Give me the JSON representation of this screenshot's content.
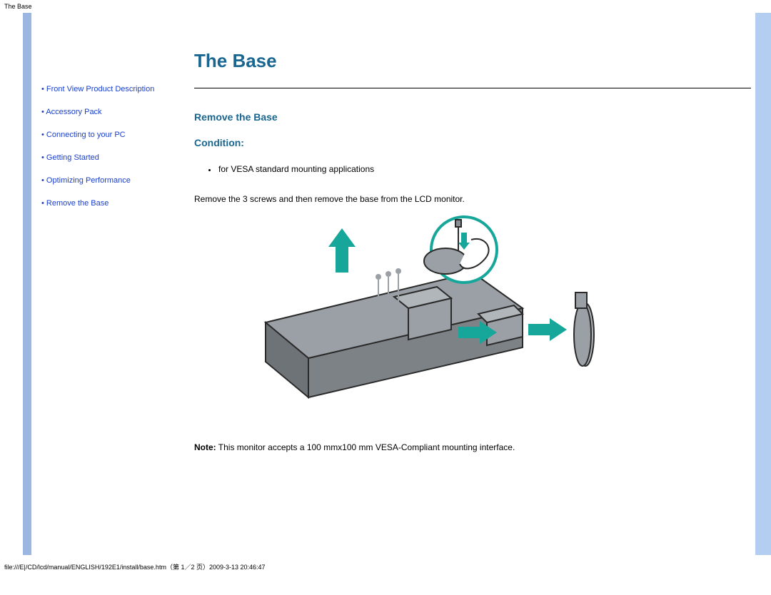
{
  "header_label": "The Base",
  "sidebar": {
    "items": [
      {
        "label": "Front View Product Description"
      },
      {
        "label": "Accessory Pack"
      },
      {
        "label": "Connecting to your PC"
      },
      {
        "label": "Getting Started"
      },
      {
        "label": "Optimizing Performance"
      },
      {
        "label": "Remove the Base"
      }
    ]
  },
  "main": {
    "title": "The Base",
    "section_title": "Remove the Base",
    "condition_label": "Condition:",
    "condition_items": [
      "for VESA standard mounting applications"
    ],
    "step_text": "Remove the 3 screws and then remove the base from the LCD monitor.",
    "note_label": "Note:",
    "note_text": " This monitor accepts a 100 mmx100 mm VESA-Compliant mounting interface."
  },
  "footer": "file:///E|/CD/lcd/manual/ENGLISH/192E1/install/base.htm（第 1／2 页）2009-3-13 20:46:47"
}
